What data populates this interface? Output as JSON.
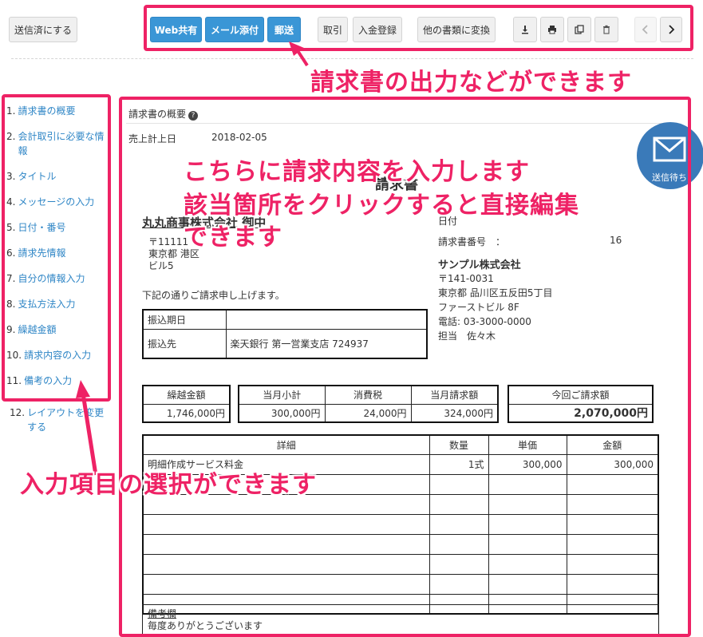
{
  "toolbar": {
    "mark_sent": "送信済にする",
    "web_share": "Web共有",
    "mail_attach": "メール添付",
    "post": "郵送",
    "transaction": "取引",
    "payment_register": "入金登録",
    "convert": "他の書類に変換",
    "icons": [
      "download-icon",
      "print-icon",
      "copy-icon",
      "trash-icon",
      "chevron-left-icon",
      "chevron-right-icon"
    ]
  },
  "nav": {
    "items": [
      {
        "num": "1.",
        "label": "請求書の概要"
      },
      {
        "num": "2.",
        "label": "会計取引に必要な情報"
      },
      {
        "num": "3.",
        "label": "タイトル"
      },
      {
        "num": "4.",
        "label": "メッセージの入力"
      },
      {
        "num": "5.",
        "label": "日付・番号"
      },
      {
        "num": "6.",
        "label": "請求先情報"
      },
      {
        "num": "7.",
        "label": "自分の情報入力"
      },
      {
        "num": "8.",
        "label": "支払方法入力"
      },
      {
        "num": "9.",
        "label": "繰越金額"
      },
      {
        "num": "10.",
        "label": "請求内容の入力"
      },
      {
        "num": "11.",
        "label": "備考の入力"
      },
      {
        "num": "12.",
        "label": "レイアウトを変更する"
      }
    ]
  },
  "overview": {
    "title": "請求書の概要",
    "date_label": "売上計上日",
    "date_value": "2018-02-05"
  },
  "invoice": {
    "title": "請求書",
    "customer_name": "丸丸商事株式会社 御中",
    "customer_zip": "〒11111",
    "customer_addr": "東京都 港区",
    "customer_bldg": "ビル5",
    "message": "下記の通りご請求申し上げます。",
    "date_label": "日付",
    "number_label": "請求書番号　：",
    "number_value": "16",
    "sender_company": "サンプル株式会社",
    "sender_zip": "〒141-0031",
    "sender_addr": "東京都 品川区五反田5丁目",
    "sender_bldg": "ファーストビル 8F",
    "sender_tel": "電話: 03-3000-0000",
    "sender_contact": "担当　佐々木",
    "payment": {
      "due_label": "振込期日",
      "due_value": "",
      "bank_label": "振込先",
      "bank_value": "楽天銀行 第一営業支店 724937"
    },
    "summary": {
      "carryover_label": "繰越金額",
      "carryover_value": "1,746,000円",
      "subtotal_label": "当月小計",
      "subtotal_value": "300,000円",
      "tax_label": "消費税",
      "tax_value": "24,000円",
      "monthly_label": "当月請求額",
      "monthly_value": "324,000円",
      "total_label": "今回ご請求額",
      "total_value": "2,070,000円"
    },
    "details": {
      "headers": [
        "詳細",
        "数量",
        "単価",
        "金額"
      ],
      "rows": [
        [
          "明細作成サービス料金",
          "1式",
          "300,000",
          "300,000"
        ]
      ]
    },
    "notes_label": "備考欄",
    "notes_value": "毎度ありがとうございます"
  },
  "send_button": "送信待ち",
  "annotations": {
    "toolbar": "請求書の出力などができます",
    "content_line1": "こちらに請求内容を入力します",
    "content_line2": "該当箇所をクリックすると直接編集",
    "content_line3": "できます",
    "nav": "入力項目の選択ができます"
  },
  "colors": {
    "accent": "#3a96d6",
    "annotation": "#ee2265",
    "send_circle": "#3a7ab9"
  }
}
